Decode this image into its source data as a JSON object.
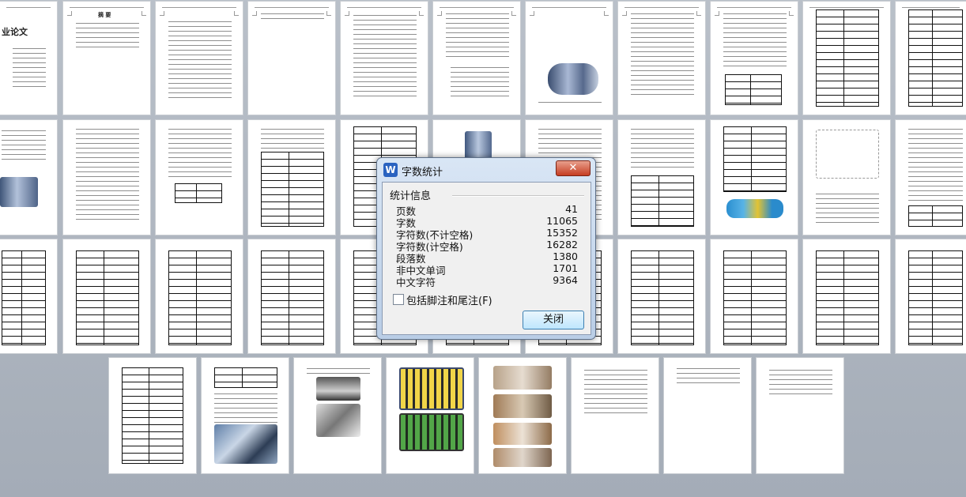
{
  "document_pages": {
    "title_page_heading": "毕业论文",
    "title_page_label": "业论文",
    "total_pages_visible": 41
  },
  "dialog": {
    "app_icon": "wps-writer-icon",
    "title": "字数统计",
    "section_label": "统计信息",
    "stats": [
      {
        "label": "页数",
        "value": "41"
      },
      {
        "label": "字数",
        "value": "11065"
      },
      {
        "label": "字符数(不计空格)",
        "value": "15352"
      },
      {
        "label": "字符数(计空格)",
        "value": "16282"
      },
      {
        "label": "段落数",
        "value": "1380"
      },
      {
        "label": "非中文单词",
        "value": "1701"
      },
      {
        "label": "中文字符",
        "value": "9364"
      }
    ],
    "checkbox_label": "包括脚注和尾注(F)",
    "checkbox_checked": false,
    "close_button_label": "关闭",
    "close_x_label": "✕"
  },
  "colors": {
    "background": "#a9b1bb",
    "dialog_title_bg": "#c9d9ee",
    "close_x": "#c94a30",
    "button": "#d6eefb"
  }
}
